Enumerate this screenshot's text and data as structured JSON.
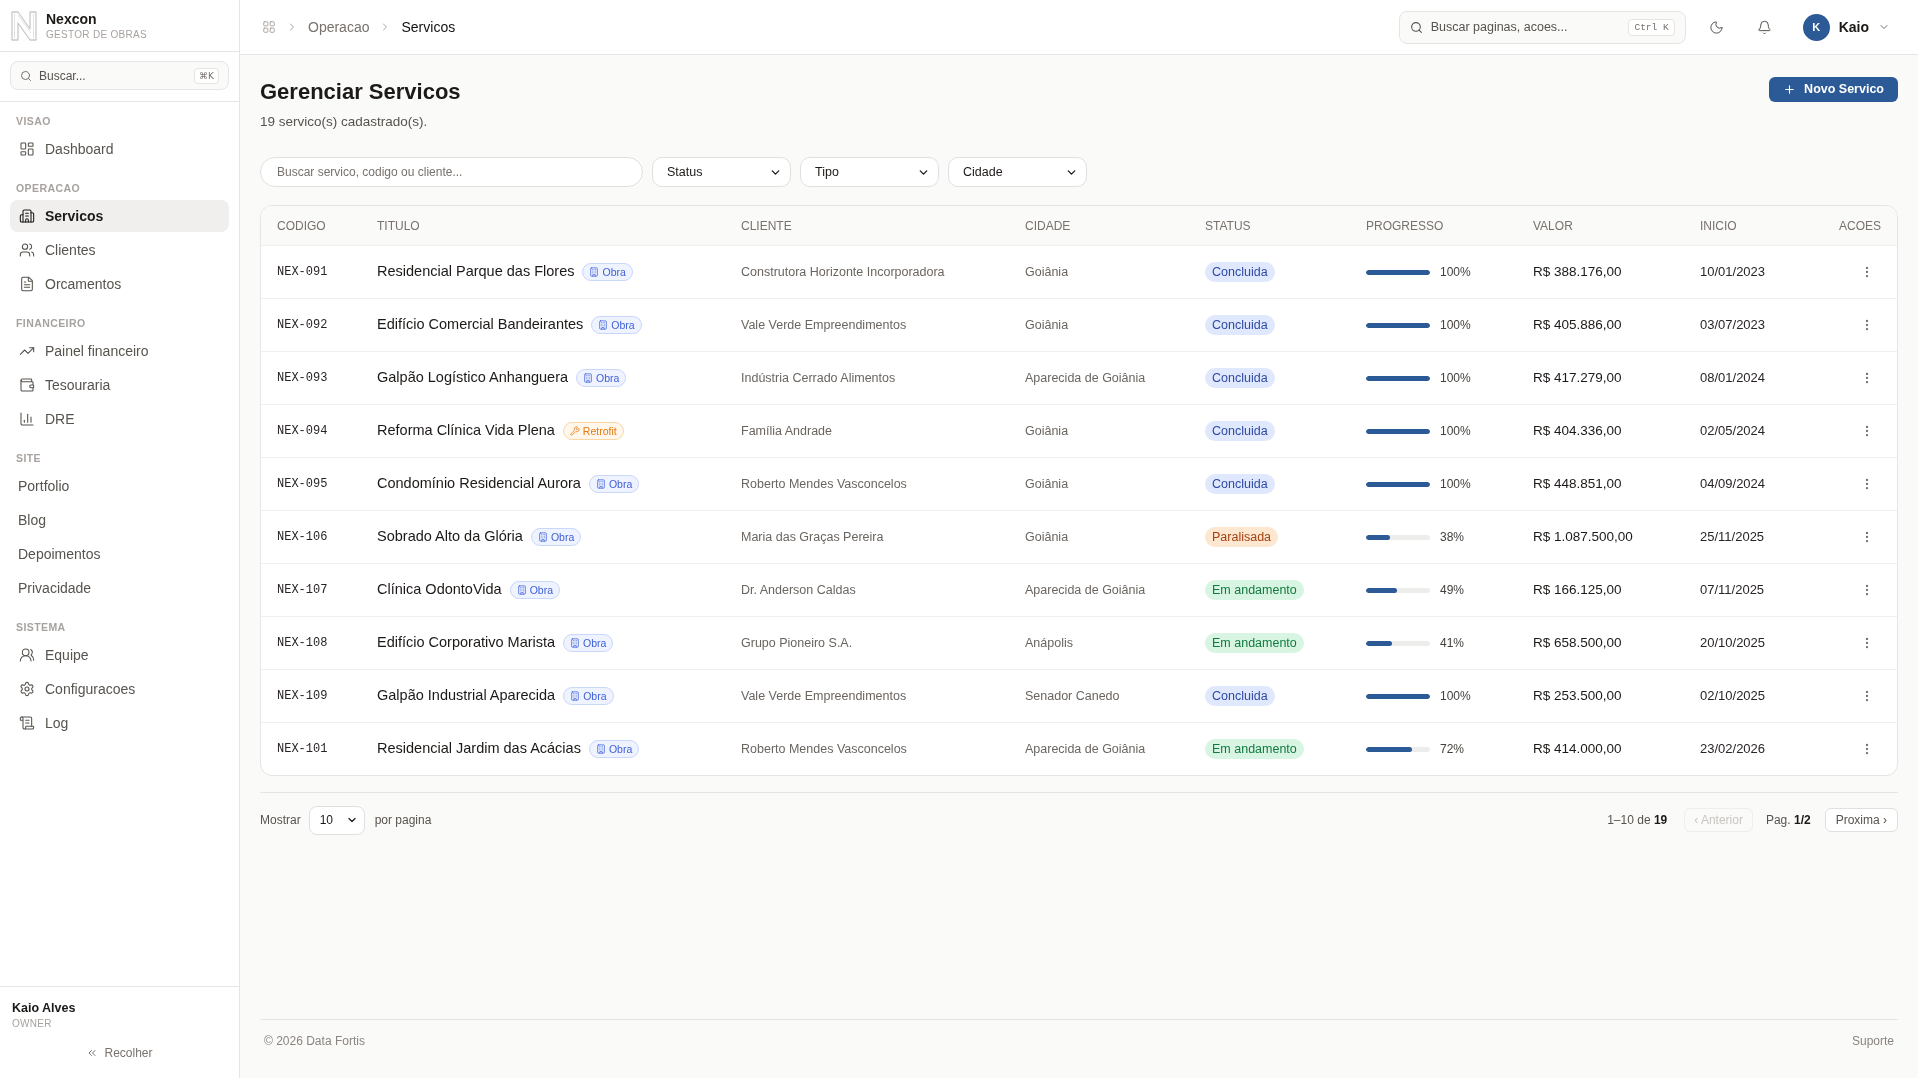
{
  "sidebar": {
    "brand": {
      "name": "Nexcon",
      "subtitle": "GESTOR DE OBRAS"
    },
    "search": {
      "placeholder": "Buscar...",
      "shortcut": "⌘K"
    },
    "sections": [
      {
        "label": "VISAO",
        "items": [
          {
            "label": "Dashboard",
            "selected": false
          }
        ]
      },
      {
        "label": "OPERACAO",
        "items": [
          {
            "label": "Servicos",
            "selected": true
          },
          {
            "label": "Clientes",
            "selected": false
          },
          {
            "label": "Orcamentos",
            "selected": false
          }
        ]
      },
      {
        "label": "FINANCEIRO",
        "items": [
          {
            "label": "Painel financeiro",
            "selected": false
          },
          {
            "label": "Tesouraria",
            "selected": false
          },
          {
            "label": "DRE",
            "selected": false
          }
        ]
      },
      {
        "label": "SITE",
        "items": [
          {
            "label": "Portfolio",
            "selected": false
          },
          {
            "label": "Blog",
            "selected": false
          },
          {
            "label": "Depoimentos",
            "selected": false
          },
          {
            "label": "Privacidade",
            "selected": false
          }
        ]
      },
      {
        "label": "SISTEMA",
        "items": [
          {
            "label": "Equipe",
            "selected": false
          },
          {
            "label": "Configuracoes",
            "selected": false
          },
          {
            "label": "Log",
            "selected": false
          }
        ]
      }
    ],
    "user": {
      "name": "Kaio Alves",
      "role": "OWNER"
    },
    "collapse": "Recolher"
  },
  "topbar": {
    "breadcrumb": [
      {
        "label": "Operacao",
        "current": false
      },
      {
        "label": "Servicos",
        "current": true
      }
    ],
    "search": {
      "placeholder": "Buscar paginas, acoes...",
      "shortcut": "Ctrl K"
    },
    "user": {
      "initial": "K",
      "name": "Kaio"
    }
  },
  "page": {
    "title": "Gerenciar Servicos",
    "subtitle": "19 servico(s) cadastrado(s).",
    "new_button": "Novo Servico"
  },
  "filters": {
    "search": {
      "placeholder": "Buscar servico, codigo ou cliente..."
    },
    "selects": [
      {
        "value": "Status"
      },
      {
        "value": "Tipo"
      },
      {
        "value": "Cidade"
      }
    ]
  },
  "table": {
    "columns": [
      "CODIGO",
      "TITULO",
      "CLIENTE",
      "CIDADE",
      "STATUS",
      "PROGRESSO",
      "VALOR",
      "INICIO",
      "ACOES"
    ],
    "rows": [
      {
        "code": "NEX-091",
        "title": "Residencial Parque das Flores",
        "tag": {
          "label": "Obra",
          "kind": "obra"
        },
        "client": "Construtora Horizonte Incorporadora",
        "city": "Goiânia",
        "status": {
          "label": "Concluida",
          "kind": "done"
        },
        "progress": {
          "level": 1,
          "reading": "100%"
        },
        "value": "R$ 388.176,00",
        "start": "10/01/2023"
      },
      {
        "code": "NEX-092",
        "title": "Edifício Comercial Bandeirantes",
        "tag": {
          "label": "Obra",
          "kind": "obra"
        },
        "client": "Vale Verde Empreendimentos",
        "city": "Goiânia",
        "status": {
          "label": "Concluida",
          "kind": "done"
        },
        "progress": {
          "level": 1,
          "reading": "100%"
        },
        "value": "R$ 405.886,00",
        "start": "03/07/2023"
      },
      {
        "code": "NEX-093",
        "title": "Galpão Logístico Anhanguera",
        "tag": {
          "label": "Obra",
          "kind": "obra"
        },
        "client": "Indústria Cerrado Alimentos",
        "city": "Aparecida de Goiânia",
        "status": {
          "label": "Concluida",
          "kind": "done"
        },
        "progress": {
          "level": 1,
          "reading": "100%"
        },
        "value": "R$ 417.279,00",
        "start": "08/01/2024"
      },
      {
        "code": "NEX-094",
        "title": "Reforma Clínica Vida Plena",
        "tag": {
          "label": "Retrofit",
          "kind": "retrofit"
        },
        "client": "Família Andrade",
        "city": "Goiânia",
        "status": {
          "label": "Concluida",
          "kind": "done"
        },
        "progress": {
          "level": 1,
          "reading": "100%"
        },
        "value": "R$ 404.336,00",
        "start": "02/05/2024"
      },
      {
        "code": "NEX-095",
        "title": "Condomínio Residencial Aurora",
        "tag": {
          "label": "Obra",
          "kind": "obra"
        },
        "client": "Roberto Mendes Vasconcelos",
        "city": "Goiânia",
        "status": {
          "label": "Concluida",
          "kind": "done"
        },
        "progress": {
          "level": 1,
          "reading": "100%"
        },
        "value": "R$ 448.851,00",
        "start": "04/09/2024"
      },
      {
        "code": "NEX-106",
        "title": "Sobrado Alto da Glória",
        "tag": {
          "label": "Obra",
          "kind": "obra"
        },
        "client": "Maria das Graças Pereira",
        "city": "Goiânia",
        "status": {
          "label": "Paralisada",
          "kind": "paused"
        },
        "progress": {
          "level": 0.38,
          "reading": "38%"
        },
        "value": "R$ 1.087.500,00",
        "start": "25/11/2025"
      },
      {
        "code": "NEX-107",
        "title": "Clínica OdontoVida",
        "tag": {
          "label": "Obra",
          "kind": "obra"
        },
        "client": "Dr. Anderson Caldas",
        "city": "Aparecida de Goiânia",
        "status": {
          "label": "Em andamento",
          "kind": "active"
        },
        "progress": {
          "level": 0.49,
          "reading": "49%"
        },
        "value": "R$ 166.125,00",
        "start": "07/11/2025"
      },
      {
        "code": "NEX-108",
        "title": "Edifício Corporativo Marista",
        "tag": {
          "label": "Obra",
          "kind": "obra"
        },
        "client": "Grupo Pioneiro S.A.",
        "city": "Anápolis",
        "status": {
          "label": "Em andamento",
          "kind": "active"
        },
        "progress": {
          "level": 0.41,
          "reading": "41%"
        },
        "value": "R$ 658.500,00",
        "start": "20/10/2025"
      },
      {
        "code": "NEX-109",
        "title": "Galpão Industrial Aparecida",
        "tag": {
          "label": "Obra",
          "kind": "obra"
        },
        "client": "Vale Verde Empreendimentos",
        "city": "Senador Canedo",
        "status": {
          "label": "Concluida",
          "kind": "done"
        },
        "progress": {
          "level": 1,
          "reading": "100%"
        },
        "value": "R$ 253.500,00",
        "start": "02/10/2025"
      },
      {
        "code": "NEX-101",
        "title": "Residencial Jardim das Acácias",
        "tag": {
          "label": "Obra",
          "kind": "obra"
        },
        "client": "Roberto Mendes Vasconcelos",
        "city": "Aparecida de Goiânia",
        "status": {
          "label": "Em andamento",
          "kind": "active"
        },
        "progress": {
          "level": 0.72,
          "reading": "72%"
        },
        "value": "R$ 414.000,00",
        "start": "23/02/2026"
      }
    ]
  },
  "pagination": {
    "show_label": "Mostrar",
    "page_size": "10",
    "per_page_label": "por pagina",
    "range": "1–10 de **19**",
    "previous": {
      "label": "‹ Anterior",
      "disabled": true
    },
    "page": "Pag. **1/2**",
    "next": {
      "label": "Proxima ›",
      "disabled": false
    }
  },
  "footer": {
    "copyright": "© 2026 Data Fortis",
    "link": "Suporte"
  }
}
